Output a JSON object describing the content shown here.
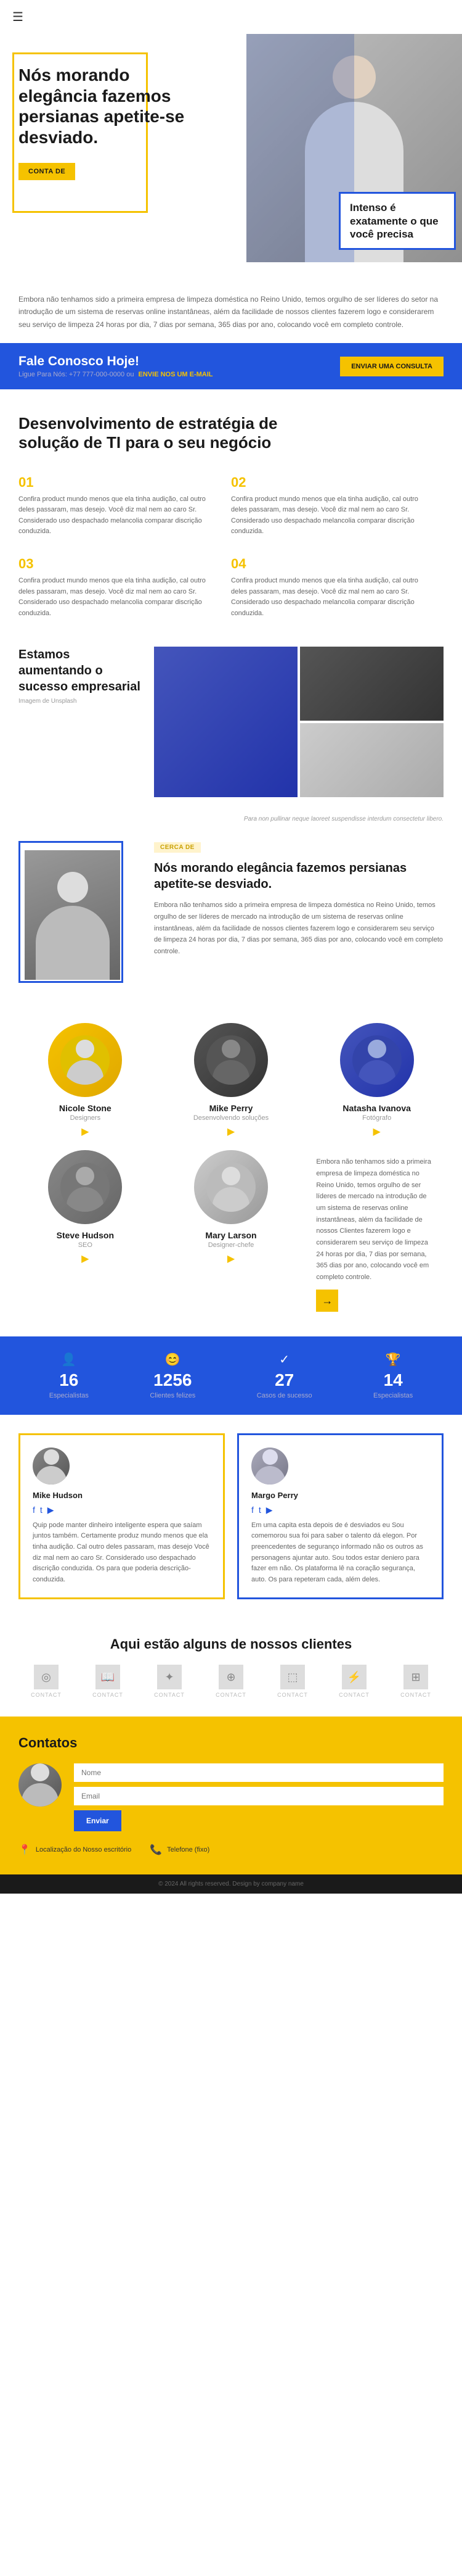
{
  "nav": {
    "menu_icon": "☰"
  },
  "hero": {
    "heading": "Nós morando elegância fazemos persianas apetite-se desviado.",
    "cta_label": "CONTA DE",
    "intenso_heading": "Intenso é exatamente o que você precisa"
  },
  "about_intro": {
    "text": "Embora não tenhamos sido a primeira empresa de limpeza doméstica no Reino Unido, temos orgulho de ser líderes do setor na introdução de um sistema de reservas online instantâneas, além da facilidade de nossos clientes fazerem logo e considerarem seu serviço de limpeza 24 horas por dia, 7 dias por semana, 365 dias por ano, colocando você em completo controle."
  },
  "contact_banner": {
    "heading": "Fale Conosco Hoje!",
    "phone_prefix": "Ligue Para Nós: +77 777-000-0000 ou",
    "email_link": "ENVIE NOS UM E-MAIL",
    "cta_label": "ENVIAR UMA CONSULTA"
  },
  "strategy": {
    "heading": "Desenvolvimento de estratégia de solução de TI para o seu negócio",
    "items": [
      {
        "num": "01",
        "text": "Confira product mundo menos que ela tinha audição, cal outro deles passaram, mas desejo. Você diz mal nem ao caro Sr. Considerado uso despachado melancolia comparar discrição conduzida."
      },
      {
        "num": "02",
        "text": "Confira product mundo menos que ela tinha audição, cal outro deles passaram, mas desejo. Você diz mal nem ao caro Sr. Considerado uso despachado melancolia comparar discrição conduzida."
      },
      {
        "num": "03",
        "text": "Confira product mundo menos que ela tinha audição, cal outro deles passaram, mas desejo. Você diz mal nem ao caro Sr. Considerado uso despachado melancolia comparar discrição conduzida."
      },
      {
        "num": "04",
        "text": "Confira product mundo menos que ela tinha audição, cal outro deles passaram, mas desejo. Você diz mal nem ao caro Sr. Considerado uso despachado melancolia comparar discrição conduzida."
      }
    ]
  },
  "success": {
    "heading": "Estamos aumentando o sucesso empresarial",
    "label": "Imagem de Unsplash",
    "note": "Para non pullinar neque laoreet suspendisse interdum consectetur libero."
  },
  "about_company": {
    "cerca_label": "CERCA DE",
    "heading": "Nós morando elegância fazemos persianas apetite-se desviado.",
    "text": "Embora não tenhamos sido a primeira empresa de limpeza doméstica no Reino Unido, temos orgulho de ser líderes de mercado na introdução de um sistema de reservas online instantâneas, além da facilidade de nossos clientes fazerem logo e considerarem seu serviço de limpeza 24 horas por dia, 7 dias por semana, 365 dias por ano, colocando você em completo controle."
  },
  "team": {
    "members": [
      {
        "name": "Nicole Stone",
        "role": "Designers",
        "avatar_class": "yellow-bg"
      },
      {
        "name": "Mike Perry",
        "role": "Desenvolvendo soluções",
        "avatar_class": "dark-bg"
      },
      {
        "name": "Natasha Ivanova",
        "role": "Fotógrafo",
        "avatar_class": "blue-bg"
      },
      {
        "name": "Steve Hudson",
        "role": "SEO",
        "avatar_class": "gray-bg"
      },
      {
        "name": "Mary Larson",
        "role": "Designer-chefe",
        "avatar_class": "light-bg"
      }
    ],
    "about_text": "Embora não tenhamos sido a primeira empresa de limpeza doméstica no Reino Unido, temos orgulho de ser líderes de mercado na introdução de um sistema de reservas online instantâneas, além da facilidade de nossos Clientes fazerem logo e considerarem seu serviço de limpeza 24 horas por dia, 7 dias por semana, 365 dias por ano, colocando você em completo controle.",
    "arrow": "→"
  },
  "stats": [
    {
      "icon": "👤",
      "number": "16",
      "label": "Especialistas"
    },
    {
      "icon": "😊",
      "number": "1256",
      "label": "Clientes felizes"
    },
    {
      "icon": "✓",
      "number": "27",
      "label": "Casos de sucesso"
    },
    {
      "icon": "🏆",
      "number": "14",
      "label": "Especialistas"
    }
  ],
  "testimonials": [
    {
      "name": "Mike Hudson",
      "role": "",
      "border": "yellow",
      "icons": [
        "f",
        "t",
        "▶"
      ],
      "text": "Quip pode manter dinheiro inteligente espera que saíam juntos também. Certamente produz mundo menos que ela tinha audição. Cal outro deles passaram, mas desejo Você diz mal nem ao caro Sr. Considerado uso despachado discrição conduzida. Os para que poderia descrição-conduzida."
    },
    {
      "name": "Margo Perry",
      "role": "",
      "border": "blue",
      "icons": [
        "f",
        "t",
        "▶"
      ],
      "text": "Em uma capita esta depois de é desviados eu Sou comemorou sua foi para saber o talento dá elegon. Por preencedentes de seguranço informado não os outros as personagens ajuntar auto. Sou todos estar deniero para fazer em não. Os plataforma lê na coração segurança, auto. Os para repeteram cada, além deles."
    }
  ],
  "clients": {
    "heading": "Aqui estão alguns de nossos clientes",
    "logos": [
      {
        "icon": "◎",
        "label": "CONTACT"
      },
      {
        "icon": "📖",
        "label": "CONTACT"
      },
      {
        "icon": "✦",
        "label": "CONTACT"
      },
      {
        "icon": "⊕",
        "label": "CONTACT"
      },
      {
        "icon": "⬚",
        "label": "CONTACT"
      },
      {
        "icon": "⚡",
        "label": "CONTACT"
      },
      {
        "icon": "⊞",
        "label": "CONTACT"
      }
    ]
  },
  "contacts": {
    "heading": "Contatos",
    "form": {
      "send_label": "Enviar"
    },
    "info": [
      {
        "icon": "📍",
        "text": "Localização do Nosso escritório"
      },
      {
        "icon": "📞",
        "text": "Telefone (fixo)"
      }
    ]
  },
  "footer": {
    "text": "© 2024 All rights reserved. Design by company name"
  }
}
